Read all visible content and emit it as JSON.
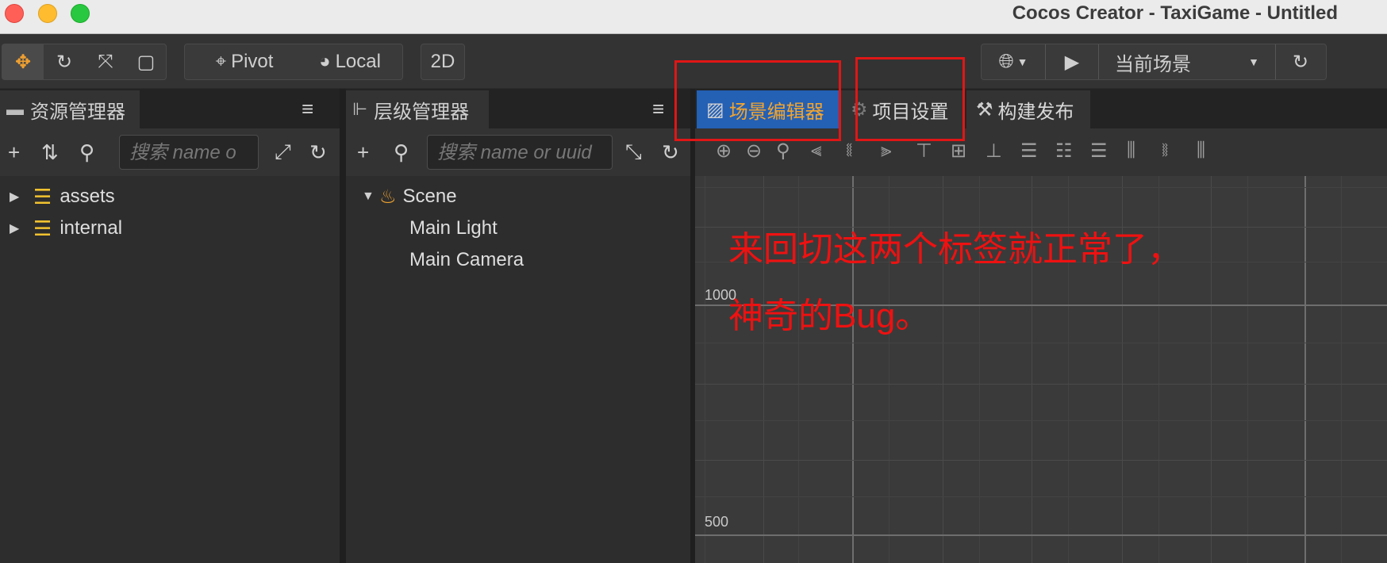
{
  "window": {
    "title": "Cocos Creator - TaxiGame - Untitled"
  },
  "toolbar": {
    "pivot_label": "Pivot",
    "local_label": "Local",
    "mode_2d_label": "2D",
    "scene_select_value": "当前场景"
  },
  "assets_panel": {
    "tab_label": "资源管理器",
    "search_placeholder": "搜索 name o",
    "items": [
      {
        "label": "assets"
      },
      {
        "label": "internal"
      }
    ]
  },
  "hierarchy_panel": {
    "tab_label": "层级管理器",
    "search_placeholder": "搜索 name or uuid",
    "root": "Scene",
    "children": [
      {
        "label": "Main Light"
      },
      {
        "label": "Main Camera"
      }
    ]
  },
  "scene_panel": {
    "tabs": [
      {
        "label": "场景编辑器"
      },
      {
        "label": "项目设置"
      },
      {
        "label": "构建发布"
      }
    ],
    "grid_labels": [
      "1000",
      "500"
    ]
  },
  "annotation": {
    "line1": "来回切这两个标签就正常了，",
    "line2": "神奇的Bug。"
  },
  "colors": {
    "active_tab_bg": "#2460b4",
    "active_tab_text": "#f2a530",
    "annotation_red": "#ee1111",
    "folder_yellow": "#f2c230"
  }
}
